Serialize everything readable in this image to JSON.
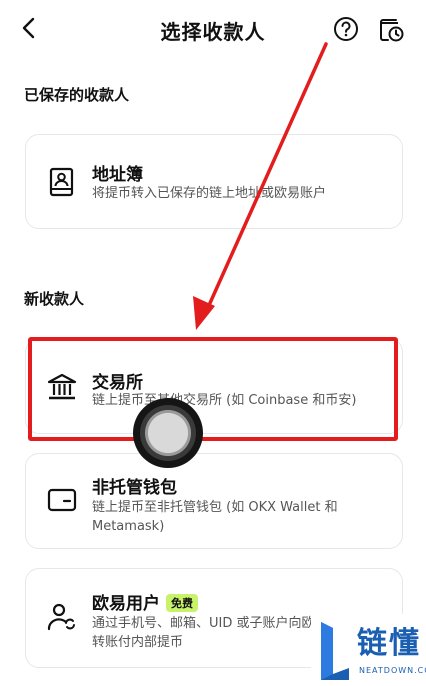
{
  "header": {
    "title": "选择收款人",
    "back_icon": "chevron-left-icon",
    "help_icon": "question-circle-icon",
    "history_icon": "document-clock-icon"
  },
  "saved_section": {
    "title": "已保存的收款人",
    "items": [
      {
        "name": "地址簿",
        "desc": "将提币转入已保存的链上地址或欧易账户",
        "icon": "address-book-icon"
      }
    ]
  },
  "new_section": {
    "title": "新收款人",
    "items": [
      {
        "name": "交易所",
        "desc": "链上提币至其他交易所 (如 Coinbase 和币安)",
        "icon": "bank-icon"
      },
      {
        "name": "非托管钱包",
        "desc": "链上提币至非托管钱包 (如 OKX Wallet 和 Metamask)",
        "icon": "wallet-icon"
      },
      {
        "name": "欧易用户",
        "badge": "免费",
        "desc": "通过手机号、邮箱、UID 或子账户向欧易用户转账付内部提币",
        "icon": "user-transfer-icon"
      }
    ]
  },
  "watermark": {
    "text": "链懂",
    "sub": "NEATDOWN.COM"
  },
  "colors": {
    "highlight": "#e31d1d",
    "arrow": "#e31d1d",
    "badge": "#c8f26a",
    "watermark": "#1b5fb2"
  }
}
